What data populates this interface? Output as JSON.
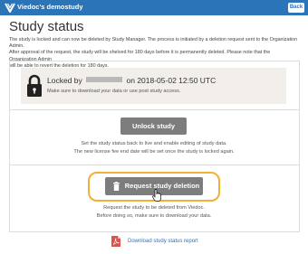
{
  "header": {
    "app_title": "Viedoc's demostudy",
    "back_label": "Back",
    "brand_color": "#2b74b8"
  },
  "page": {
    "title": "Study status",
    "info_lines": [
      "The study is locked and can now be deleted by Study Manager. The process is initiated by a deletion request sent to the Organization Admin.",
      "After approval of the request, the study will be shelved for 180 days before it is permanently deleted. Please note that the Organization Admin",
      "will be able to revert the deletion for 180 days."
    ]
  },
  "locked": {
    "prefix": "Locked by",
    "suffix": "on 2018-05-02 12:50 UTC",
    "note": "Make sure to download your data or use post study access.",
    "icon": "lock-icon"
  },
  "unlock": {
    "button_label": "Unlock study",
    "desc_line1": "Set the study status back to live and enable editing of study data.",
    "desc_line2": "The new license fee end date will be set once the study is locked again."
  },
  "deletion": {
    "button_label": "Request study deletion",
    "button_icon": "trash-icon",
    "highlight_color": "#f2b037",
    "desc_line1": "Request the study to be deleted from Viedoc.",
    "desc_line2": "Before doing so, make sure to download your data."
  },
  "report": {
    "link_label": "Download study status report",
    "icon": "pdf-icon"
  }
}
